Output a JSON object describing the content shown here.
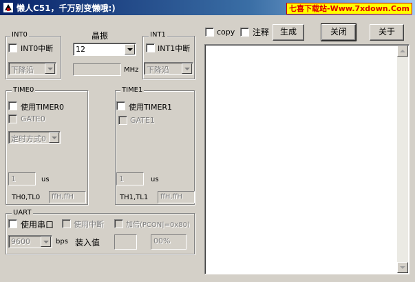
{
  "window": {
    "title": "懒人C51，千万别变懒哦:)",
    "icon": "c51-app-icon"
  },
  "watermark": "七喜下载站-Www.7xdown.Com",
  "int0": {
    "group_label": "INT0",
    "enable_label": "INT0中断",
    "enabled": false,
    "trigger_value": "下降沿"
  },
  "crystal": {
    "label": "晶振",
    "value": "12",
    "freq_value": "",
    "unit": "MHz"
  },
  "int1": {
    "group_label": "INT1",
    "enable_label": "INT1中断",
    "enabled": false,
    "trigger_value": "下降沿"
  },
  "options": {
    "copy_label": "copy",
    "copy_checked": false,
    "comment_label": "注释",
    "comment_checked": false
  },
  "buttons": {
    "generate": "生成",
    "close": "关闭",
    "about": "关于"
  },
  "timer0": {
    "group_label": "TIME0",
    "enable_label": "使用TIMER0",
    "gate_label": "GATE0",
    "mode_value": "定时方式0",
    "time_value": "1",
    "time_unit": "us",
    "reg_label": "TH0,TL0",
    "reg_value": "ffH,ffH"
  },
  "timer1": {
    "group_label": "TIME1",
    "enable_label": "使用TIMER1",
    "gate_label": "GATE1",
    "time_value": "1",
    "time_unit": "us",
    "reg_label": "TH1,TL1",
    "reg_value": "ffH,ffH"
  },
  "uart": {
    "group_label": "UART",
    "enable_label": "使用串口",
    "interrupt_label": "使用中断",
    "double_label": "加倍(PCON|=0x80)",
    "baud_value": "9600",
    "baud_unit": "bps",
    "load_label": "装入值",
    "load_value": "",
    "error_value": "00%"
  },
  "output": {
    "text": ""
  },
  "colors": {
    "title_start": "#0a246a",
    "title_end": "#a6caf0",
    "watermark_bg": "#ffff00",
    "watermark_fg": "#e00000",
    "face": "#d4d0c8"
  }
}
